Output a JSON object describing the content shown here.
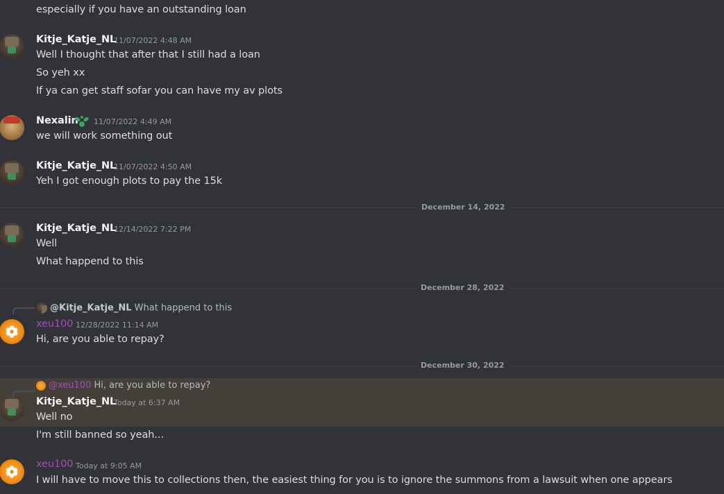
{
  "messages": {
    "m0": {
      "lines": [
        "especially if you have an outstanding loan"
      ]
    },
    "m1": {
      "author": "Kitje_Katje_NL",
      "timestamp": "11/07/2022 4:48 AM",
      "lines": [
        "Well I thought that after that I still had a loan",
        "So yeh xx",
        "If ya can get staff sofar you can have my av plots"
      ]
    },
    "m2": {
      "author": "Nexalin",
      "timestamp": "11/07/2022 4:49 AM",
      "lines": [
        "we will work something out"
      ]
    },
    "m3": {
      "author": "Kitje_Katje_NL",
      "timestamp": "11/07/2022 4:50 AM",
      "lines": [
        "Yeh I got enough plots to pay the 15k"
      ]
    },
    "m4": {
      "author": "Kitje_Katje_NL",
      "timestamp": "12/14/2022 7:22 PM",
      "lines": [
        "Well",
        "What happend to this"
      ]
    },
    "m5": {
      "author": "xeu100",
      "timestamp": "12/28/2022 11:14 AM",
      "lines": [
        "Hi, are you able to repay?"
      ],
      "reply": {
        "author": "@Kitje_Katje_NL",
        "text": "What happend to this"
      }
    },
    "m6": {
      "author": "Kitje_Katje_NL",
      "timestamp": "Today at 6:37 AM",
      "lines": [
        "Well no",
        "I'm still banned so yeah..."
      ],
      "reply": {
        "author": "@xeu100",
        "text": "Hi, are you able to repay?"
      }
    },
    "m7": {
      "author": "xeu100",
      "timestamp": "Today at 9:05 AM",
      "lines": [
        "I will have to move this to collections then, the easiest thing for you is to ignore the summons from a lawsuit when one appears"
      ]
    }
  },
  "dividers": [
    "December 14, 2022",
    "December 28, 2022",
    "December 30, 2022"
  ],
  "icons": {
    "nexalin_badge": "sprout-badge-icon",
    "xeu_avatar": "orange-flower-avatar"
  },
  "colors": {
    "background": "#313338",
    "highlight": "#444039",
    "xeu_name": "#a052b4",
    "badge": "#3ba55d"
  }
}
